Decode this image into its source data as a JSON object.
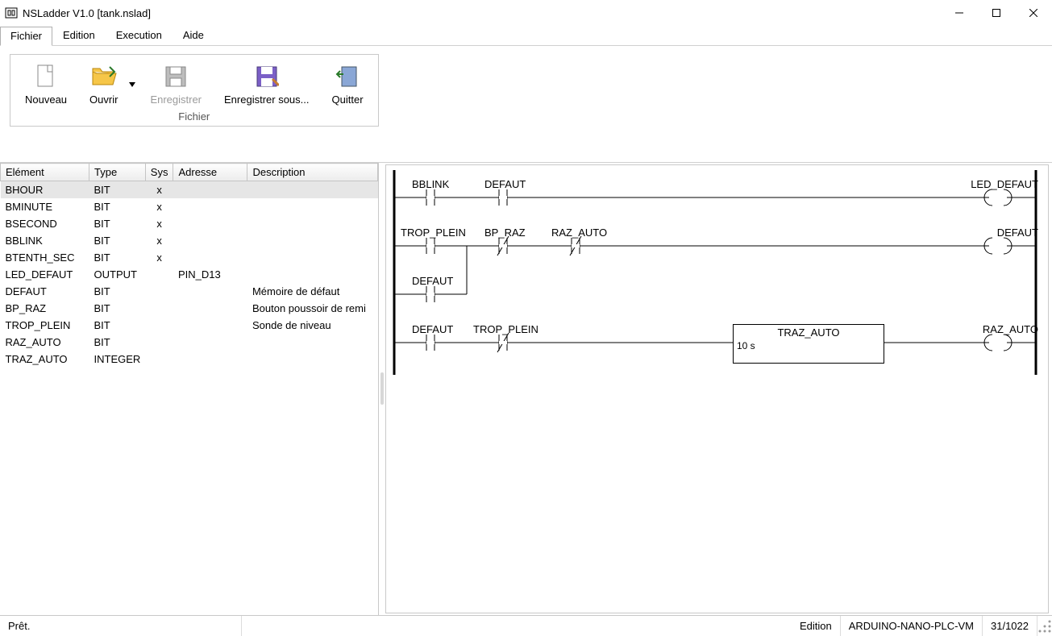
{
  "window": {
    "title": "NSLadder V1.0  [tank.nslad]"
  },
  "menu": {
    "tabs": [
      "Fichier",
      "Edition",
      "Execution",
      "Aide"
    ],
    "active": 0
  },
  "ribbon": {
    "group_caption": "Fichier",
    "items": [
      {
        "id": "new",
        "label": "Nouveau",
        "disabled": false
      },
      {
        "id": "open",
        "label": "Ouvrir",
        "disabled": false,
        "dropdown": true
      },
      {
        "id": "save",
        "label": "Enregistrer",
        "disabled": true
      },
      {
        "id": "saveas",
        "label": "Enregistrer sous...",
        "disabled": false
      },
      {
        "id": "quit",
        "label": "Quitter",
        "disabled": false
      }
    ]
  },
  "table": {
    "headers": {
      "element": "Elément",
      "type": "Type",
      "sys": "Sys",
      "address": "Adresse",
      "description": "Description"
    },
    "rows": [
      {
        "element": "BHOUR",
        "type": "BIT",
        "sys": "x",
        "address": "",
        "description": ""
      },
      {
        "element": "BMINUTE",
        "type": "BIT",
        "sys": "x",
        "address": "",
        "description": ""
      },
      {
        "element": "BSECOND",
        "type": "BIT",
        "sys": "x",
        "address": "",
        "description": ""
      },
      {
        "element": "BBLINK",
        "type": "BIT",
        "sys": "x",
        "address": "",
        "description": ""
      },
      {
        "element": "BTENTH_SEC",
        "type": "BIT",
        "sys": "x",
        "address": "",
        "description": ""
      },
      {
        "element": "LED_DEFAUT",
        "type": "OUTPUT",
        "sys": "",
        "address": "PIN_D13",
        "description": ""
      },
      {
        "element": "DEFAUT",
        "type": "BIT",
        "sys": "",
        "address": "",
        "description": "Mémoire de défaut"
      },
      {
        "element": "BP_RAZ",
        "type": "BIT",
        "sys": "",
        "address": "",
        "description": "Bouton poussoir de remi"
      },
      {
        "element": "TROP_PLEIN",
        "type": "BIT",
        "sys": "",
        "address": "",
        "description": "Sonde de niveau"
      },
      {
        "element": "RAZ_AUTO",
        "type": "BIT",
        "sys": "",
        "address": "",
        "description": ""
      },
      {
        "element": "TRAZ_AUTO",
        "type": "INTEGER",
        "sys": "",
        "address": "",
        "description": ""
      }
    ],
    "selected": 0
  },
  "ladder": {
    "labels": {
      "r1c1": "BBLINK",
      "r1c2": "DEFAUT",
      "r1out": "LED_DEFAUT",
      "r2c1": "TROP_PLEIN",
      "r2c2": "BP_RAZ",
      "r2c3": "RAZ_AUTO",
      "r2out": "DEFAUT",
      "r2b1": "DEFAUT",
      "r3c1": "DEFAUT",
      "r3c2": "TROP_PLEIN",
      "r3out": "RAZ_AUTO",
      "timer_name": "TRAZ_AUTO",
      "timer_val": "10 s"
    }
  },
  "status": {
    "ready": "Prêt.",
    "mode": "Edition",
    "target": "ARDUINO-NANO-PLC-VM",
    "pos": "31/1022"
  }
}
